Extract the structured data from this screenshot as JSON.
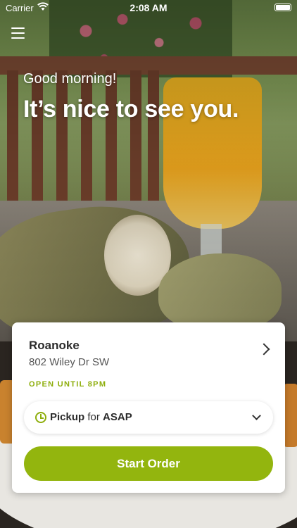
{
  "status_bar": {
    "carrier": "Carrier",
    "time": "2:08 AM"
  },
  "greeting": "Good morning!",
  "headline": "It’s nice to see you.",
  "store": {
    "name": "Roanoke",
    "address": "802 Wiley Dr SW",
    "hours": "OPEN UNTIL 8PM"
  },
  "pickup": {
    "mode": "Pickup",
    "connector": "for",
    "time": "ASAP"
  },
  "start_button": "Start Order",
  "colors": {
    "accent": "#93b50e",
    "open_text": "#8eae0c"
  },
  "icons": [
    "menu-icon",
    "wifi-icon",
    "battery-icon",
    "chevron-right-icon",
    "clock-icon",
    "chevron-down-icon"
  ]
}
